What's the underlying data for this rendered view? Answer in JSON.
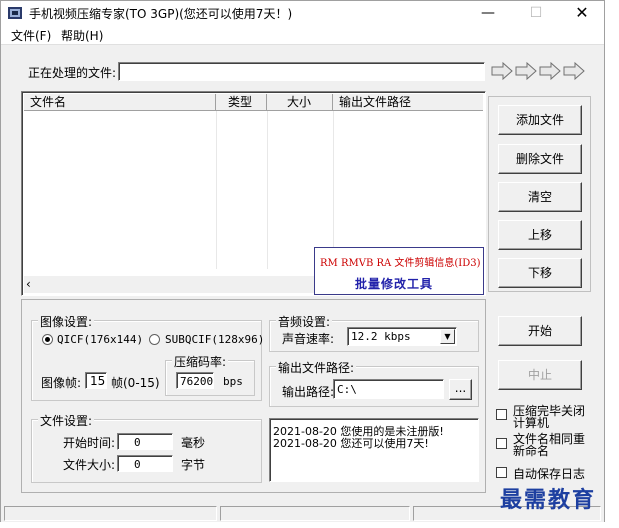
{
  "window": {
    "title": "手机视频压缩专家(TO 3GP)(您还可以使用7天！)",
    "min": "—",
    "max": "☐",
    "close": "✕"
  },
  "menu": {
    "file": "文件(F)",
    "help": "帮助(H)"
  },
  "processing": {
    "label": "正在处理的文件:",
    "value": ""
  },
  "file_list": {
    "columns": [
      "文件名",
      "类型",
      "大小",
      "输出文件路径"
    ],
    "rows": []
  },
  "promo": {
    "red_text": "RM RMVB RA 文件剪辑信息(ID3)",
    "blue_text": "批量修改工具"
  },
  "side_buttons": {
    "add": "添加文件",
    "delete": "删除文件",
    "clear": "清空",
    "up": "上移",
    "down": "下移"
  },
  "image_settings": {
    "title": "图像设置:",
    "radio_qcif": "QICF(176x144)",
    "radio_subqcif": "SUBQCIF(128x96)",
    "selected": "qcif",
    "fps_label": "图像帧:",
    "fps_value": "15",
    "fps_range": "帧(0-15)",
    "bitrate_title": "压缩码率:",
    "bitrate_value": "76200",
    "bitrate_unit": "bps"
  },
  "audio_settings": {
    "title": "音频设置:",
    "rate_label": "声音速率:",
    "rate_value": "12.2 kbps"
  },
  "output": {
    "title": "输出文件路径:",
    "path_label": "输出路径:",
    "path_value": "C:\\",
    "browse": "..."
  },
  "file_settings": {
    "title": "文件设置:",
    "start_label": "开始时间:",
    "start_value": "0",
    "start_unit": "毫秒",
    "size_label": "文件大小:",
    "size_value": "0",
    "size_unit": "字节"
  },
  "log": {
    "lines": [
      "2021-08-20 您使用的是未注册版!",
      "2021-08-20 您还可以使用7天!"
    ]
  },
  "actions": {
    "start": "开始",
    "stop": "中止"
  },
  "options": {
    "shutdown_line1": "压缩完毕关闭",
    "shutdown_line2": "计算机",
    "rename_line1": "文件名相同重",
    "rename_line2": "新命名",
    "autosave_log": "自动保存日志"
  },
  "watermark": "最需教育",
  "colors": {
    "window_bg": "#f0f0f0",
    "promo_red": "#cc0000",
    "promo_blue": "#2222aa",
    "watermark": "#1d3fa0"
  }
}
